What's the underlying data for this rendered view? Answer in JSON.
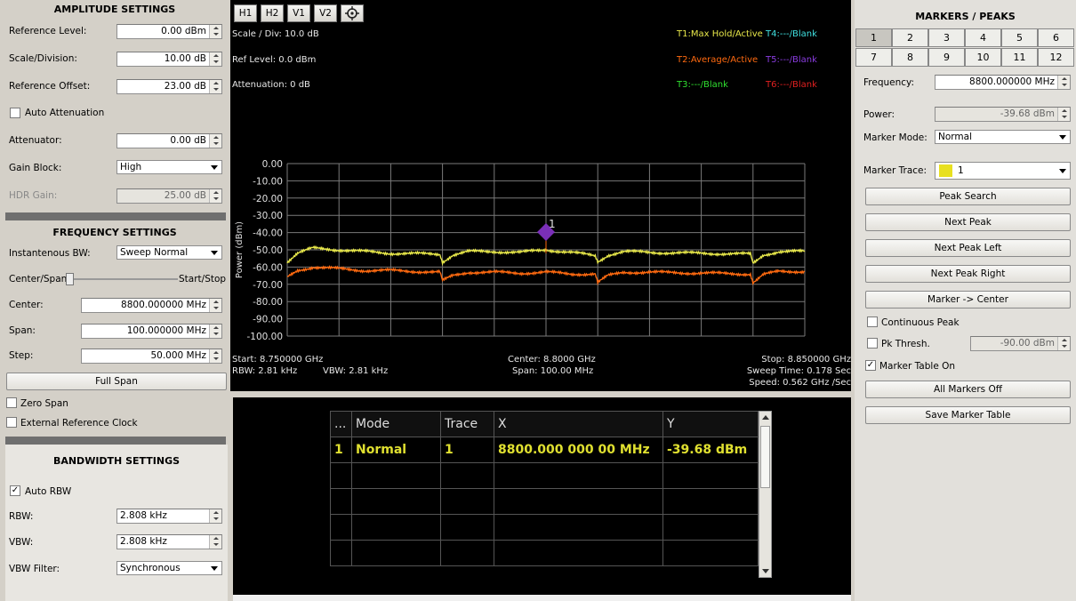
{
  "amplitude": {
    "title": "AMPLITUDE SETTINGS",
    "ref_level_label": "Reference Level:",
    "ref_level": "0.00 dBm",
    "scale_label": "Scale/Division:",
    "scale": "10.00 dB",
    "ref_offset_label": "Reference Offset:",
    "ref_offset": "23.00 dB",
    "auto_atten_label": "Auto Attenuation",
    "attenuator_label": "Attenuator:",
    "attenuator": "0.00 dB",
    "gain_block_label": "Gain Block:",
    "gain_block": "High",
    "hdr_gain_label": "HDR Gain:",
    "hdr_gain": "25.00 dB"
  },
  "frequency": {
    "title": "FREQUENCY SETTINGS",
    "ibw_label": "Instantenous BW:",
    "ibw": "Sweep Normal",
    "cs_left": "Center/Span",
    "cs_right": "Start/Stop",
    "center_label": "Center:",
    "center": "8800.000000 MHz",
    "span_label": "Span:",
    "span": "100.000000 MHz",
    "step_label": "Step:",
    "step": "50.000 MHz",
    "full_span": "Full Span",
    "zero_span": "Zero Span",
    "ext_ref": "External Reference Clock"
  },
  "bandwidth": {
    "title": "BANDWIDTH SETTINGS",
    "auto_rbw": "Auto RBW",
    "rbw_label": "RBW:",
    "rbw": "2.808 kHz",
    "vbw_label": "VBW:",
    "vbw": "2.808 kHz",
    "vbw_filter_label": "VBW Filter:",
    "vbw_filter": "Synchronous"
  },
  "toolbar": {
    "h1": "H1",
    "h2": "H2",
    "v1": "V1",
    "v2": "V2"
  },
  "plot": {
    "scale_div": "Scale / Div: 10.0 dB",
    "ref_level": "Ref Level: 0.0 dBm",
    "attenuation": "Attenuation: 0 dB",
    "traces": [
      {
        "label": "T1:Max Hold/Active",
        "color": "#e8e84a"
      },
      {
        "label": "T4:---/Blank",
        "color": "#40e0e0"
      },
      {
        "label": "T2:Average/Active",
        "color": "#ff6a10"
      },
      {
        "label": "T5:---/Blank",
        "color": "#8a3ce0"
      },
      {
        "label": "T3:---/Blank",
        "color": "#30e030"
      },
      {
        "label": "T6:---/Blank",
        "color": "#e02020"
      }
    ],
    "start": "Start: 8.750000 GHz",
    "center": "Center: 8.8000 GHz",
    "stop": "Stop: 8.850000 GHz",
    "rbw": "RBW: 2.81 kHz",
    "vbw": "VBW: 2.81 kHz",
    "span": "Span: 100.00 MHz",
    "sweep_time": "Sweep Time: 0.178 Sec",
    "speed": "Speed: 0.562 GHz /Sec",
    "marker_label": "1"
  },
  "chart_data": {
    "type": "line",
    "ylabel": "Power (dBm)",
    "ylim": [
      -100,
      0
    ],
    "xlim": [
      8750,
      8850
    ],
    "yticks": [
      "0.00",
      "-10.00",
      "-20.00",
      "-30.00",
      "-40.00",
      "-50.00",
      "-60.00",
      "-70.00",
      "-80.00",
      "-90.00",
      "-100.00"
    ],
    "series": [
      {
        "name": "T1:Max Hold/Active",
        "color": "#e8e84a",
        "x": [
          8750,
          8752,
          8755,
          8760,
          8765,
          8770,
          8779.5,
          8780,
          8782,
          8785,
          8790,
          8795,
          8800,
          8805,
          8809.5,
          8810,
          8812,
          8815,
          8820,
          8830,
          8839.5,
          8840,
          8842,
          8845,
          8850
        ],
        "y": [
          -57,
          -52,
          -49,
          -50,
          -51,
          -52,
          -52.5,
          -57,
          -53,
          -51,
          -51,
          -51.5,
          -50,
          -51.5,
          -53.5,
          -57,
          -53,
          -51,
          -51.5,
          -52,
          -52.5,
          -58,
          -53,
          -51,
          -51
        ]
      },
      {
        "name": "T2:Average/Active",
        "color": "#ff6a10",
        "x": [
          8750,
          8752,
          8755,
          8760,
          8765,
          8770,
          8779.5,
          8780,
          8782,
          8785,
          8790,
          8795,
          8800,
          8805,
          8809.5,
          8810,
          8812,
          8815,
          8820,
          8830,
          8839.5,
          8840,
          8842,
          8845,
          8850
        ],
        "y": [
          -66,
          -62,
          -60,
          -61,
          -62,
          -62,
          -63,
          -68,
          -65,
          -63,
          -63,
          -63.5,
          -63,
          -64,
          -64,
          -69,
          -65,
          -63,
          -63,
          -63.5,
          -64,
          -69,
          -64.5,
          -62.5,
          -62.5
        ]
      }
    ],
    "markers": [
      {
        "label": "1",
        "x": 8800,
        "y": -39.68
      }
    ]
  },
  "marker_table": {
    "headers": [
      "...",
      "Mode",
      "Trace",
      "X",
      "Y"
    ],
    "rows": [
      {
        "num": "1",
        "mode": "Normal",
        "trace": "1",
        "x": "8800.000 000 00 MHz",
        "y": "-39.68 dBm"
      }
    ]
  },
  "markers_panel": {
    "title": "MARKERS / PEAKS",
    "numbers": [
      "1",
      "2",
      "3",
      "4",
      "5",
      "6",
      "7",
      "8",
      "9",
      "10",
      "11",
      "12"
    ],
    "freq_label": "Frequency:",
    "freq": "8800.000000 MHz",
    "power_label": "Power:",
    "power": "-39.68 dBm",
    "mode_label": "Marker Mode:",
    "mode": "Normal",
    "trace_label": "Marker Trace:",
    "trace": "1",
    "trace_color": "#e8e020",
    "peak_search": "Peak Search",
    "next_peak": "Next Peak",
    "next_left": "Next Peak Left",
    "next_right": "Next Peak Right",
    "to_center": "Marker -> Center",
    "continuous": "Continuous Peak",
    "pk_thresh_label": "Pk Thresh.",
    "pk_thresh": "-90.00 dBm",
    "table_on": "Marker Table On",
    "all_off": "All Markers Off",
    "save_table": "Save Marker Table"
  }
}
